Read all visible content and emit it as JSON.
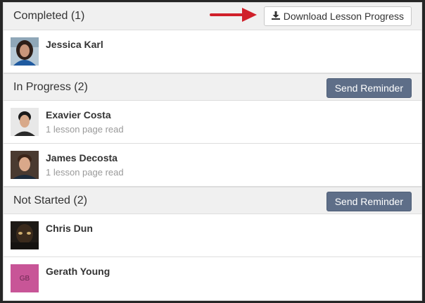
{
  "sections": {
    "completed": {
      "title": "Completed (1)",
      "action_label": "Download Lesson Progress",
      "students": [
        {
          "name": "Jessica Karl",
          "progress": ""
        }
      ]
    },
    "in_progress": {
      "title": "In Progress (2)",
      "action_label": "Send Reminder",
      "students": [
        {
          "name": "Exavier Costa",
          "progress": "1 lesson page read"
        },
        {
          "name": "James Decosta",
          "progress": "1 lesson page read"
        }
      ]
    },
    "not_started": {
      "title": "Not Started (2)",
      "action_label": "Send Reminder",
      "students": [
        {
          "name": "Chris Dun",
          "progress": ""
        },
        {
          "name": "Gerath Young",
          "progress": "",
          "initials": "GB"
        }
      ]
    }
  },
  "colors": {
    "reminder_button": "#5e6e88",
    "arrow": "#d0202a",
    "initials_avatar": "#c85597"
  },
  "icons": {
    "download": "download-icon",
    "arrow": "arrow-right-icon"
  }
}
